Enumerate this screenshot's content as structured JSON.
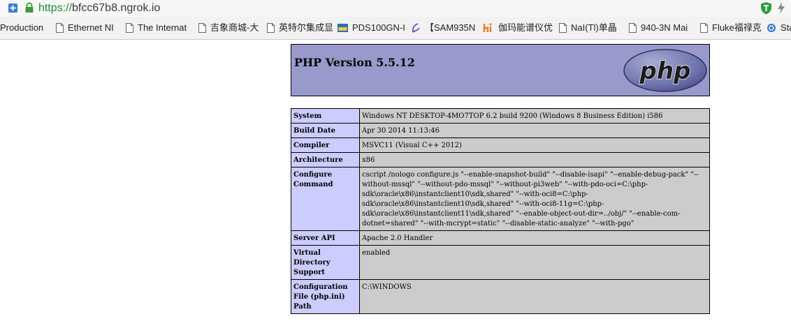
{
  "browser": {
    "url_scheme": "https://",
    "url_host": "bfcc67b8.ngrok.io",
    "bookmarks": [
      {
        "label": "Production",
        "icon": "none"
      },
      {
        "label": "Ethernet NI",
        "icon": "page-icon"
      },
      {
        "label": "The Internat",
        "icon": "page-icon"
      },
      {
        "label": "吉象商城-大",
        "icon": "page-icon"
      },
      {
        "label": "英特尔集成显",
        "icon": "page-icon"
      },
      {
        "label": "PDS100GN-I",
        "icon": "pds-icon"
      },
      {
        "label": "【SAM935N",
        "icon": "script-icon"
      },
      {
        "label": "伽玛能谱仪优",
        "icon": "hi-icon"
      },
      {
        "label": "NaI(Tl)单晶",
        "icon": "page-icon"
      },
      {
        "label": "940-3N Mai",
        "icon": "page-icon"
      },
      {
        "label": "Fluke福禄克",
        "icon": "page-icon"
      },
      {
        "label": "Sta",
        "icon": "globe-icon"
      }
    ]
  },
  "php": {
    "title": "PHP Version 5.5.12",
    "logo_text": "php",
    "rows": [
      {
        "label": "System",
        "value": "Windows NT DESKTOP-4MO7TOP 6.2 build 9200 (Windows 8 Business Edition) i586"
      },
      {
        "label": "Build Date",
        "value": "Apr 30 2014 11:13:46"
      },
      {
        "label": "Compiler",
        "value": "MSVC11 (Visual C++ 2012)"
      },
      {
        "label": "Architecture",
        "value": "x86"
      },
      {
        "label": "Configure Command",
        "value": "cscript /nologo configure.js \"--enable-snapshot-build\" \"--disable-isapi\" \"--enable-debug-pack\" \"--without-mssql\" \"--without-pdo-mssql\" \"--without-pi3web\" \"--with-pdo-oci=C:\\php-sdk\\oracle\\x86\\instantclient10\\sdk,shared\" \"--with-oci8=C:\\php-sdk\\oracle\\x86\\instantclient10\\sdk,shared\" \"--with-oci8-11g=C:\\php-sdk\\oracle\\x86\\instantclient11\\sdk,shared\" \"--enable-object-out-dir=../obj/\" \"--enable-com-dotnet=shared\" \"--with-mcrypt=static\" \"--disable-static-analyze\" \"--with-pgo\""
      },
      {
        "label": "Server API",
        "value": "Apache 2.0 Handler"
      },
      {
        "label": "Virtual Directory Support",
        "value": "enabled"
      },
      {
        "label": "Configuration File (php.ini) Path",
        "value": "C:\\WINDOWS"
      }
    ]
  },
  "colors": {
    "header_bg": "#9999cc",
    "label_bg": "#ccccff",
    "value_bg": "#cccccc",
    "url_scheme": "#1f8a33"
  }
}
